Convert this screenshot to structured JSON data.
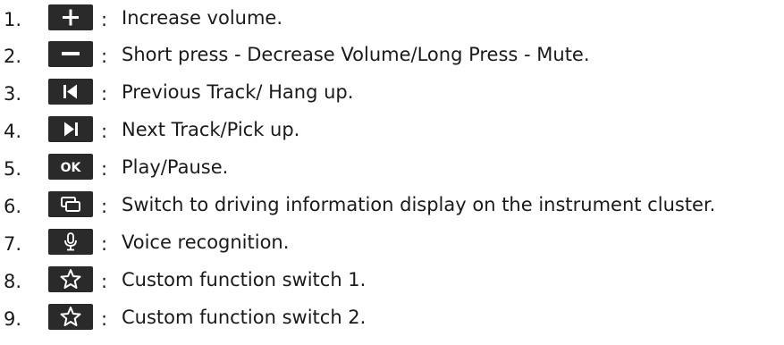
{
  "items": [
    {
      "number": "1.",
      "icon": "plus-icon",
      "separator": ":",
      "text": "Increase volume."
    },
    {
      "number": "2.",
      "icon": "minus-icon",
      "separator": ":",
      "text": "Short press - Decrease Volume/Long Press - Mute."
    },
    {
      "number": "3.",
      "icon": "previous-track-icon",
      "separator": ":",
      "text": "Previous Track/ Hang up."
    },
    {
      "number": "4.",
      "icon": "next-track-icon",
      "separator": ":",
      "text": "Next Track/Pick up."
    },
    {
      "number": "5.",
      "icon": "ok-icon",
      "icon_label": "OK",
      "separator": ":",
      "text": "Play/Pause."
    },
    {
      "number": "6.",
      "icon": "display-switch-icon",
      "separator": ":",
      "text": "Switch to driving information display on the instrument cluster."
    },
    {
      "number": "7.",
      "icon": "microphone-icon",
      "separator": ":",
      "text": "Voice recognition."
    },
    {
      "number": "8.",
      "icon": "star-icon",
      "separator": ":",
      "text": "Custom function switch 1."
    },
    {
      "number": "9.",
      "icon": "star-icon",
      "separator": ":",
      "text": "Custom function switch 2."
    }
  ],
  "colors": {
    "icon_background": "#2a2a2a",
    "icon_foreground": "#ffffff",
    "text": "#1a1a1a"
  }
}
